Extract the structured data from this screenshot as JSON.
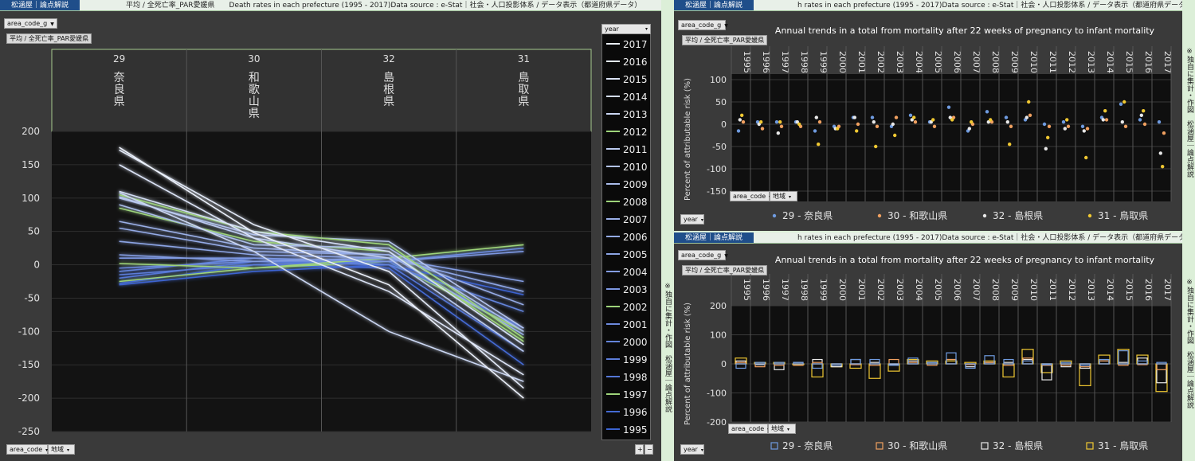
{
  "left": {
    "brand": "松涵屋｜論点解説",
    "meta": "平均 / 全死亡率_PAR愛媛県　　Death rates in each prefecture (1995 - 2017)Data source : e-Stat｜社会・人口投影体系 / データ表示（都道府県データ）",
    "filter_label": "area_code_g",
    "measure_tag": "平均 / 全死亡率_PAR愛媛県",
    "year_label": "year",
    "bottom_dd1": "area_code",
    "bottom_dd2": "地域",
    "side_note": "※独自に集計・作図　松涵屋｜論点解説",
    "zoom_plus": "+",
    "zoom_minus": "−"
  },
  "rt": {
    "brand": "松涵屋｜論点解説",
    "meta": "h rates in each prefecture (1995 - 2017)Data source : e-Stat｜社会・人口投影体系 / データ表示（都道府県データ）",
    "filter_label": "area_code_g",
    "measure_tag": "平均 / 全死亡率_PAR愛媛県",
    "title": "Annual trends in a total from mortality after 22 weeks of pregnancy to infant mortality",
    "ylabel": "Percent of attributable risk (%)",
    "dd1": "area_code",
    "dd2": "地域",
    "year_label": "year",
    "side_note": "※独自に集計・作図　松涵屋｜論点解説"
  },
  "rb": {
    "brand": "松涵屋｜論点解説",
    "meta": "h rates in each prefecture (1995 - 2017)Data source : e-Stat｜社会・人口投影体系 / データ表示（都道府県データ）",
    "filter_label": "area_code_g",
    "measure_tag": "平均 / 全死亡率_PAR愛媛県",
    "title": "Annual trends in a total from mortality after 22 weeks of pregnancy to infant mortality",
    "ylabel": "Percent of attributable risk (%)",
    "dd1": "area_code",
    "dd2": "地域",
    "year_label": "year",
    "side_note": "※独自に集計・作図　松涵屋｜論点解説"
  },
  "colors": {
    "nara": "#6f9be0",
    "wakayama": "#f0a060",
    "shimane": "#e8e8e8",
    "tottori": "#f0c832",
    "green": "#9ed47a"
  },
  "chart_data": [
    {
      "type": "line",
      "title": "",
      "categories_codes": [
        "29",
        "30",
        "32",
        "31"
      ],
      "categories": [
        "奈良県",
        "和歌山県",
        "島根県",
        "鳥取県"
      ],
      "ylim": [
        -250,
        200
      ],
      "yticks": [
        200,
        150,
        100,
        50,
        0,
        -50,
        -100,
        -150,
        -200,
        -250
      ],
      "legend_title": "year",
      "legend_position": "right",
      "series": [
        {
          "name": "2017",
          "values": [
            176,
            48,
            -30,
            -200
          ]
        },
        {
          "name": "2016",
          "values": [
            172,
            60,
            -10,
            -185
          ]
        },
        {
          "name": "2015",
          "values": [
            150,
            40,
            -40,
            -165
          ]
        },
        {
          "name": "2014",
          "values": [
            110,
            50,
            20,
            -120
          ]
        },
        {
          "name": "2013",
          "values": [
            108,
            20,
            -100,
            -175
          ]
        },
        {
          "name": "2012",
          "values": [
            105,
            50,
            30,
            -110
          ]
        },
        {
          "name": "2011",
          "values": [
            102,
            40,
            10,
            -130
          ]
        },
        {
          "name": "2010",
          "values": [
            100,
            45,
            35,
            -95
          ]
        },
        {
          "name": "2009",
          "values": [
            90,
            30,
            25,
            -100
          ]
        },
        {
          "name": "2008",
          "values": [
            85,
            35,
            20,
            -115
          ]
        },
        {
          "name": "2007",
          "values": [
            65,
            25,
            15,
            -105
          ]
        },
        {
          "name": "2006",
          "values": [
            55,
            20,
            15,
            -60
          ]
        },
        {
          "name": "2005",
          "values": [
            35,
            15,
            10,
            -40
          ]
        },
        {
          "name": "2004",
          "values": [
            15,
            5,
            10,
            -25
          ]
        },
        {
          "name": "2003",
          "values": [
            10,
            10,
            5,
            20
          ]
        },
        {
          "name": "2002",
          "values": [
            2,
            -5,
            10,
            30
          ]
        },
        {
          "name": "2001",
          "values": [
            -5,
            5,
            5,
            25
          ]
        },
        {
          "name": "2000",
          "values": [
            -10,
            10,
            0,
            -70
          ]
        },
        {
          "name": "1999",
          "values": [
            -15,
            0,
            5,
            -95
          ]
        },
        {
          "name": "1998",
          "values": [
            -20,
            5,
            0,
            -130
          ]
        },
        {
          "name": "1997",
          "values": [
            -25,
            -5,
            5,
            -100
          ]
        },
        {
          "name": "1996",
          "values": [
            -28,
            0,
            -5,
            -150
          ]
        },
        {
          "name": "1995",
          "values": [
            -30,
            -10,
            0,
            -45
          ]
        }
      ]
    },
    {
      "type": "scatter",
      "title": "Annual trends in a total from mortality after 22 weeks of pregnancy to infant mortality",
      "ylabel": "Percent of attributable risk (%)",
      "x": [
        "1995",
        "1996",
        "1997",
        "1998",
        "1999",
        "2000",
        "2001",
        "2002",
        "2003",
        "2004",
        "2005",
        "2006",
        "2007",
        "2008",
        "2009",
        "2010",
        "2011",
        "2012",
        "2013",
        "2014",
        "2015",
        "2016",
        "2017"
      ],
      "ylim": [
        -150,
        100
      ],
      "yticks": [
        100,
        50,
        0,
        -50,
        -100,
        -150
      ],
      "legend_position": "bottom",
      "series": [
        {
          "name": "29 - 奈良県",
          "values": [
            -15,
            5,
            5,
            5,
            -15,
            -5,
            15,
            15,
            -5,
            20,
            5,
            38,
            -15,
            28,
            15,
            10,
            0,
            5,
            -5,
            15,
            45,
            10,
            5
          ]
        },
        {
          "name": "30 - 和歌山県",
          "values": [
            5,
            -10,
            -5,
            -5,
            5,
            -5,
            0,
            -5,
            15,
            5,
            -5,
            15,
            0,
            5,
            -5,
            20,
            -5,
            -5,
            -10,
            10,
            -5,
            0,
            -20
          ]
        },
        {
          "name": "32 - 島根県",
          "values": [
            10,
            0,
            -20,
            5,
            15,
            -10,
            15,
            5,
            0,
            10,
            5,
            15,
            -10,
            5,
            5,
            15,
            -55,
            -10,
            -15,
            10,
            5,
            20,
            -65
          ]
        },
        {
          "name": "31 - 鳥取県",
          "values": [
            20,
            5,
            5,
            0,
            -45,
            -10,
            -15,
            -50,
            -25,
            15,
            10,
            10,
            5,
            10,
            -45,
            50,
            -30,
            10,
            -75,
            30,
            50,
            30,
            -95
          ]
        }
      ]
    },
    {
      "type": "bar",
      "title": "Annual trends in a total from mortality after 22 weeks of pregnancy to infant mortality",
      "ylabel": "Percent of attributable risk (%)",
      "x": [
        "1995",
        "1996",
        "1997",
        "1998",
        "1999",
        "2000",
        "2001",
        "2002",
        "2003",
        "2004",
        "2005",
        "2006",
        "2007",
        "2008",
        "2009",
        "2010",
        "2011",
        "2012",
        "2013",
        "2014",
        "2015",
        "2016",
        "2017"
      ],
      "ylim": [
        -200,
        200
      ],
      "yticks": [
        200,
        100,
        0,
        -100,
        -200
      ],
      "legend_position": "bottom",
      "series": [
        {
          "name": "29 - 奈良県",
          "values": [
            -15,
            5,
            5,
            5,
            -15,
            -5,
            15,
            15,
            -5,
            20,
            5,
            38,
            -15,
            28,
            15,
            10,
            0,
            5,
            -5,
            15,
            45,
            10,
            5
          ]
        },
        {
          "name": "30 - 和歌山県",
          "values": [
            5,
            -10,
            -5,
            -5,
            5,
            -5,
            0,
            -5,
            15,
            5,
            -5,
            15,
            0,
            5,
            -5,
            20,
            -5,
            -5,
            -10,
            10,
            -5,
            0,
            -20
          ]
        },
        {
          "name": "32 - 島根県",
          "values": [
            10,
            0,
            -20,
            5,
            15,
            -10,
            15,
            5,
            0,
            10,
            5,
            15,
            -10,
            5,
            5,
            15,
            -55,
            -10,
            -15,
            10,
            5,
            20,
            -65
          ]
        },
        {
          "name": "31 - 鳥取県",
          "values": [
            20,
            5,
            5,
            0,
            -45,
            -10,
            -15,
            -50,
            -25,
            15,
            10,
            10,
            5,
            10,
            -45,
            50,
            -30,
            10,
            -75,
            30,
            50,
            30,
            -95
          ]
        }
      ]
    }
  ]
}
